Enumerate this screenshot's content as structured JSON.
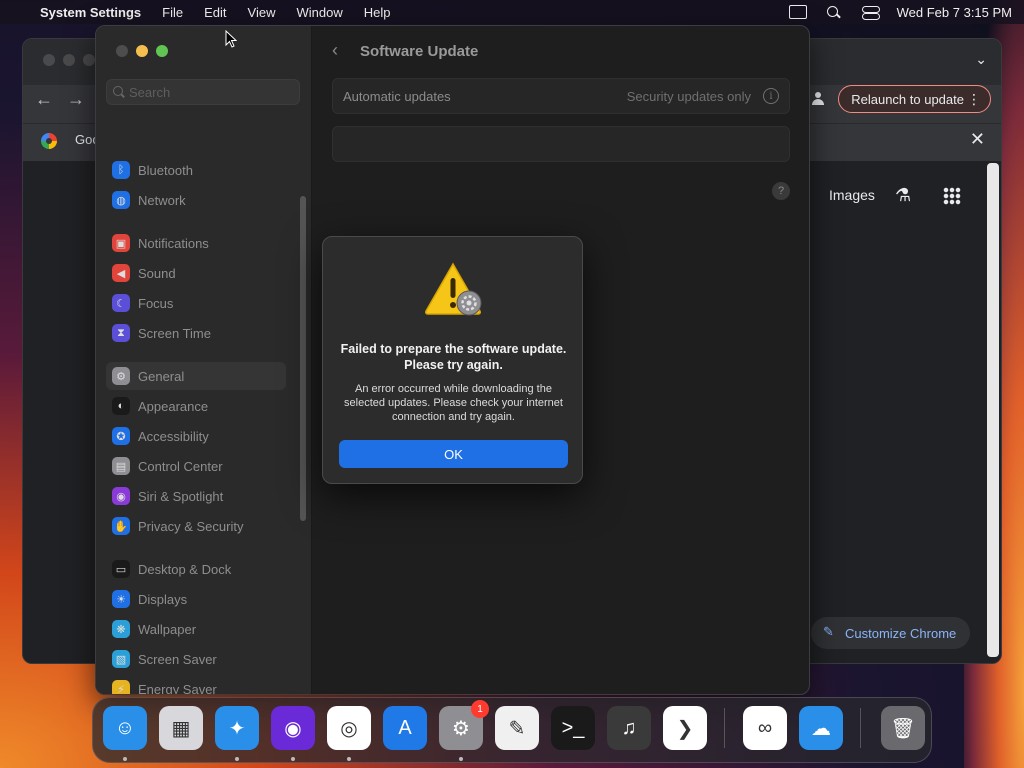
{
  "menubar": {
    "app_name": "System Settings",
    "menus": [
      "File",
      "Edit",
      "View",
      "Window",
      "Help"
    ],
    "clock": "Wed Feb 7  3:15 PM"
  },
  "chrome": {
    "relaunch_label": "Relaunch to update",
    "tab_title": "Goo",
    "images_link": "Images",
    "customize_label": "Customize Chrome"
  },
  "settings": {
    "search_placeholder": "Search",
    "pane_title": "Software Update",
    "auto_updates_label": "Automatic updates",
    "auto_updates_value": "Security updates only",
    "sidebar": [
      {
        "label": "Bluetooth",
        "icon": "bluetooth-icon",
        "color": "#1f6fe5"
      },
      {
        "label": "Network",
        "icon": "network-icon",
        "color": "#1f6fe5"
      },
      {
        "label": "Notifications",
        "icon": "notifications-icon",
        "color": "#e0443a"
      },
      {
        "label": "Sound",
        "icon": "sound-icon",
        "color": "#e0443a"
      },
      {
        "label": "Focus",
        "icon": "focus-icon",
        "color": "#5a4fd6"
      },
      {
        "label": "Screen Time",
        "icon": "screen-time-icon",
        "color": "#5a4fd6"
      },
      {
        "label": "General",
        "icon": "general-icon",
        "color": "#8e8e93"
      },
      {
        "label": "Appearance",
        "icon": "appearance-icon",
        "color": "#1a1a1a"
      },
      {
        "label": "Accessibility",
        "icon": "accessibility-icon",
        "color": "#1f6fe5"
      },
      {
        "label": "Control Center",
        "icon": "control-center-icon",
        "color": "#8e8e93"
      },
      {
        "label": "Siri & Spotlight",
        "icon": "siri-icon",
        "color": "#8a3ad6"
      },
      {
        "label": "Privacy & Security",
        "icon": "privacy-hand-icon",
        "color": "#1f6fe5"
      },
      {
        "label": "Desktop & Dock",
        "icon": "desktop-dock-icon",
        "color": "#1a1a1a"
      },
      {
        "label": "Displays",
        "icon": "displays-icon",
        "color": "#1f6fe5"
      },
      {
        "label": "Wallpaper",
        "icon": "wallpaper-icon",
        "color": "#2ba0d8"
      },
      {
        "label": "Screen Saver",
        "icon": "screen-saver-icon",
        "color": "#2ba0d8"
      },
      {
        "label": "Energy Saver",
        "icon": "energy-saver-icon",
        "color": "#e6b422"
      }
    ]
  },
  "dialog": {
    "title": "Failed to prepare the software update. Please try again.",
    "message": "An error occurred while downloading the selected updates. Please check your internet connection and try again.",
    "ok_label": "OK"
  },
  "dock": {
    "apps": [
      {
        "name": "finder",
        "color": "#2a8fe8",
        "running": true
      },
      {
        "name": "launchpad",
        "color": "#d8d8dc",
        "running": false
      },
      {
        "name": "safari",
        "color": "#2a8fe8",
        "running": true
      },
      {
        "name": "firefox",
        "color": "#6a2ad8",
        "running": true
      },
      {
        "name": "chrome",
        "color": "#ffffff",
        "running": true
      },
      {
        "name": "app-store",
        "color": "#1f7ae8",
        "running": false
      },
      {
        "name": "system-settings",
        "color": "#8e8e93",
        "running": true,
        "badge": "1"
      },
      {
        "name": "textedit",
        "color": "#f0f0f0",
        "running": false
      },
      {
        "name": "terminal",
        "color": "#1a1a1a",
        "running": false
      },
      {
        "name": "garageband",
        "color": "#3a3a3a",
        "running": false
      },
      {
        "name": "vscode",
        "color": "#ffffff",
        "running": false
      },
      {
        "name": "visual-studio",
        "color": "#ffffff",
        "running": false
      },
      {
        "name": "weather",
        "color": "#2a8fe8",
        "running": false
      },
      {
        "name": "trash",
        "color": "#6a6a6e",
        "running": false
      }
    ]
  }
}
